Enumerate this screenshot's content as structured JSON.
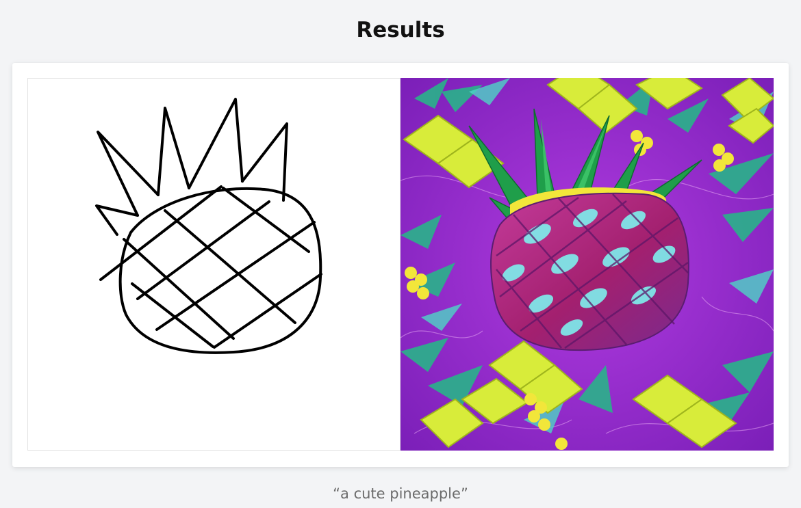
{
  "header": {
    "title": "Results"
  },
  "results": {
    "sketch_alt": "hand-drawn pineapple sketch",
    "generated_alt": "generated pineapple image"
  },
  "caption": {
    "prompt": "“a cute pineapple”"
  },
  "colors": {
    "page_background": "#f3f4f6",
    "card_background": "#ffffff",
    "title_text": "#111111",
    "caption_text": "#6b6b6b",
    "generated_background": "#8a22c9",
    "pineapple_leaf": "#1f9e4a",
    "pineapple_body": "#b0207e",
    "pineapple_highlight": "#7ef0ee",
    "pineapple_chunk": "#d8ec3a"
  }
}
